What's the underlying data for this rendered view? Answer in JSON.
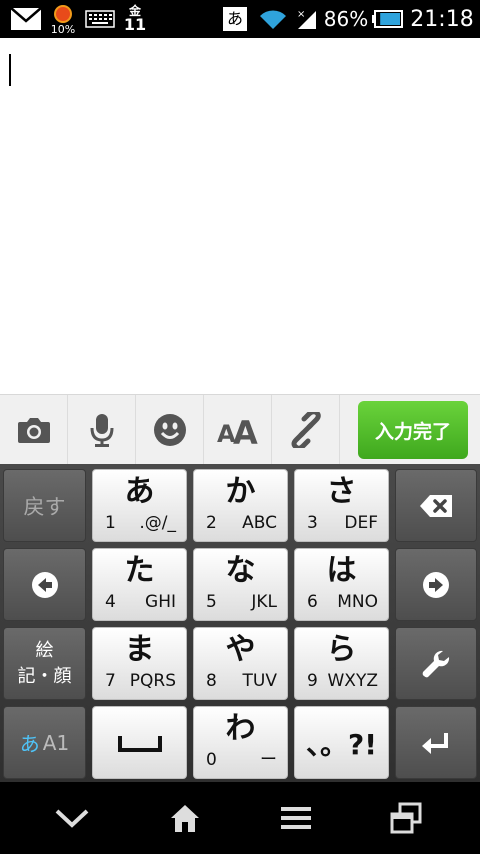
{
  "status_bar": {
    "battery_level_small": "10%",
    "weekday": "金",
    "day": "11",
    "ime_indicator": "あ",
    "battery_percent": "86%",
    "battery_fill": 0.86,
    "time": "21:18"
  },
  "editor": {
    "text": ""
  },
  "toolbar": {
    "items": [
      "camera-icon",
      "microphone-icon",
      "emoji-icon",
      "text-size-icon",
      "link-icon"
    ],
    "done_label": "入力完了"
  },
  "keyboard": {
    "back_label": "戻す",
    "emoji_line1": "絵",
    "emoji_line2": "記・顔",
    "mode_kana": "あ",
    "mode_alpha": "A1",
    "keys": [
      {
        "kana": "あ",
        "num": "1",
        "alpha": ".@/_"
      },
      {
        "kana": "か",
        "num": "2",
        "alpha": "ABC"
      },
      {
        "kana": "さ",
        "num": "3",
        "alpha": "DEF"
      },
      {
        "kana": "た",
        "num": "4",
        "alpha": "GHI"
      },
      {
        "kana": "な",
        "num": "5",
        "alpha": "JKL"
      },
      {
        "kana": "は",
        "num": "6",
        "alpha": "MNO"
      },
      {
        "kana": "ま",
        "num": "7",
        "alpha": "PQRS"
      },
      {
        "kana": "や",
        "num": "8",
        "alpha": "TUV"
      },
      {
        "kana": "ら",
        "num": "9",
        "alpha": "WXYZ"
      },
      {
        "kana": "わ",
        "num": "0",
        "alpha": "ー"
      }
    ],
    "punct_label": "、。?!"
  },
  "nav_bar": {
    "items": [
      "hide-keyboard-icon",
      "home-icon",
      "menu-icon",
      "recent-apps-icon"
    ]
  }
}
